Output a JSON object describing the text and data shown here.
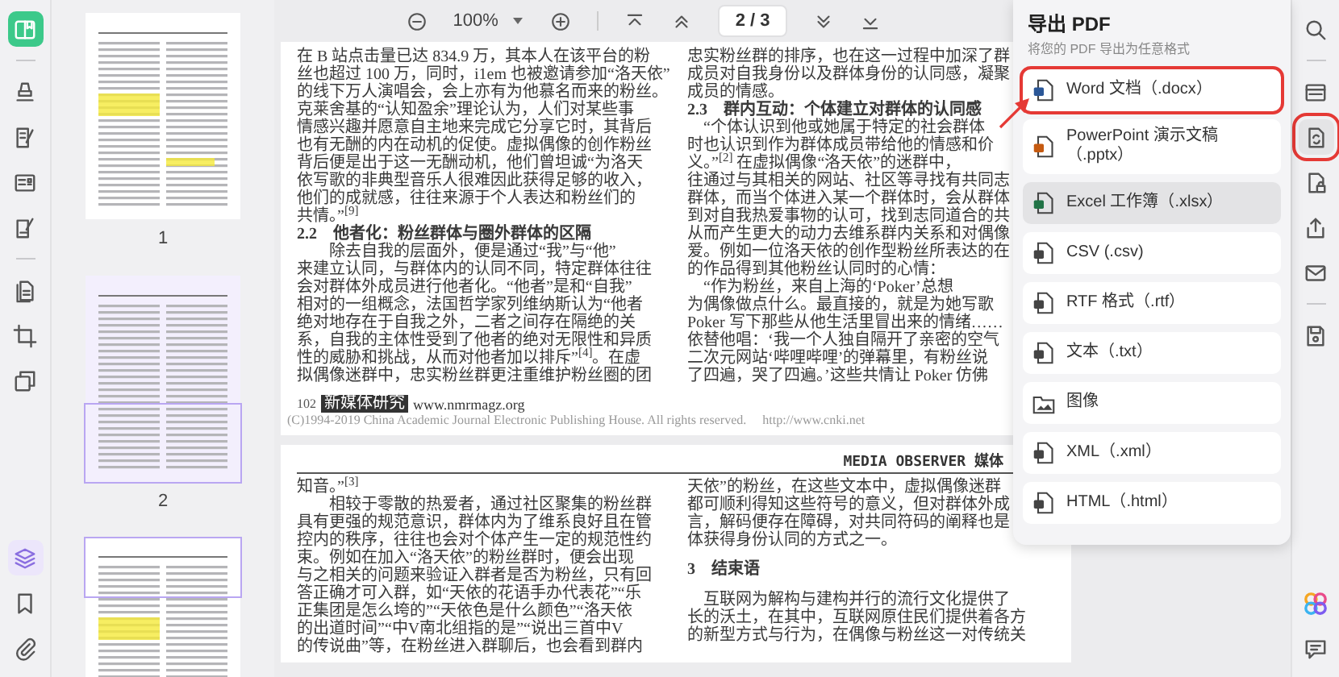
{
  "left_rail": {
    "groups": [
      [
        {
          "kind": "reader",
          "selected": true
        }
      ],
      [
        {
          "kind": "comment",
          "selected": false
        },
        {
          "kind": "edit",
          "selected": false
        },
        {
          "kind": "form",
          "selected": false
        },
        {
          "kind": "sign",
          "selected": false
        }
      ],
      [
        {
          "kind": "organize",
          "selected": false
        },
        {
          "kind": "crop",
          "selected": false
        },
        {
          "kind": "compress",
          "selected": false
        }
      ]
    ],
    "bottom": [
      {
        "kind": "layers",
        "selected": true
      },
      {
        "kind": "bookmark",
        "selected": false
      },
      {
        "kind": "attachment",
        "selected": false
      }
    ]
  },
  "thumbnails": [
    {
      "label": "1",
      "selected": false,
      "highlights": true
    },
    {
      "label": "2",
      "selected": true,
      "highlights": false
    },
    {
      "selected": false,
      "highlights": true
    }
  ],
  "toolbar": {
    "zoom": "100%",
    "page": "2 / 3"
  },
  "pages": [
    {
      "columns": [
        [
          {
            "kind": "body",
            "text": "在 B 站点击量已达 834.9 万，其本人在该平台的粉"
          },
          {
            "kind": "body",
            "text": "丝也超过 100 万，同时，i1em 也被邀请参加“洛天依”"
          },
          {
            "kind": "body",
            "text": "的线下万人演唱会，会上亦有为他慕名而来的粉丝。"
          },
          {
            "kind": "body",
            "text": "克莱舍基的“认知盈余”理论认为，人们对某些事"
          },
          {
            "kind": "body",
            "text": "情感兴趣并愿意自主地来完成它分享它时，其背后"
          },
          {
            "kind": "body",
            "text": "也有无酬的内在动机的促使。虚拟偶像的创作粉丝"
          },
          {
            "kind": "body",
            "text": "背后便是出于这一无酬动机，他们曾坦诚“为洛天"
          },
          {
            "kind": "body",
            "text": "依写歌的非典型音乐人很难因此获得足够的收入，"
          },
          {
            "kind": "body",
            "text": "他们的成就感，往往来源于个人表达和粉丝们的"
          },
          {
            "kind": "body",
            "text": "共情。”$^{[9]}$"
          },
          {
            "kind": "heading",
            "text": "2.2　他者化：粉丝群体与圈外群体的区隔"
          },
          {
            "kind": "body",
            "text": "　　除去自我的层面外，便是通过“我”与“他”"
          },
          {
            "kind": "body",
            "text": "来建立认同，与群体内的认同不同，特定群体往往"
          },
          {
            "kind": "body",
            "text": "会对群体外成员进行他者化。“他者”是和“自我”"
          },
          {
            "kind": "body",
            "text": "相对的一组概念，法国哲学家列维纳斯认为“他者"
          },
          {
            "kind": "body",
            "text": "绝对地存在于自我之外，二者之间存在隔绝的关"
          },
          {
            "kind": "body",
            "text": "系，自我的主体性受到了他者的绝对无限性和异质"
          },
          {
            "kind": "body",
            "text": "性的威胁和挑战，从而对他者加以排斥”$^{[4]}$。在虚"
          },
          {
            "kind": "body",
            "text": "拟偶像迷群中，忠实粉丝群更注重维护粉丝圈的团"
          }
        ],
        [
          {
            "kind": "body",
            "text": "忠实粉丝群的排序，也在这一过程中加深了群"
          },
          {
            "kind": "body",
            "text": "成员对自我身份以及群体身份的认同感，凝聚"
          },
          {
            "kind": "body",
            "text": "成员的情感。"
          },
          {
            "kind": "heading",
            "text": "2.3　群内互动：个体建立对群体的认同感"
          },
          {
            "kind": "body",
            "text": "　“个体认识到他或她属于特定的社会群体"
          },
          {
            "kind": "body",
            "text": "时也认识到作为群体成员带给他的情感和价"
          },
          {
            "kind": "body",
            "text": "义。”$^{[2]}$ 在虚拟偶像“洛天依”的迷群中，"
          },
          {
            "kind": "body",
            "text": "往通过与其相关的网站、社区等寻找有共同志"
          },
          {
            "kind": "body",
            "text": "群体，而当个体进入某一个群体时，会从群体"
          },
          {
            "kind": "body",
            "text": "到对自我热爱事物的认可，找到志同道合的共"
          },
          {
            "kind": "body",
            "text": "从而产生更大的动力去维系群内关系和对偶像"
          },
          {
            "kind": "body",
            "text": "爱。例如一位洛天依的创作型粉丝所表达的在"
          },
          {
            "kind": "body",
            "text": "的作品得到其他粉丝认同时的心情："
          },
          {
            "kind": "body",
            "text": "　“作为粉丝，来自上海的‘Poker’总想"
          },
          {
            "kind": "body",
            "text": "为偶像做点什么。最直接的，就是为她写歌"
          },
          {
            "kind": "body",
            "text": "Poker 写下那些从他生活里冒出来的情绪……"
          },
          {
            "kind": "body",
            "text": "依替他唱：‘我一个人独自隔开了亲密的空气"
          },
          {
            "kind": "body",
            "text": "二次元网站‘哔哩哔哩’的弹幕里，有粉丝说"
          },
          {
            "kind": "body",
            "text": "了四遍，哭了四遍。’这些共情让 Poker 仿佛"
          }
        ]
      ],
      "footer": {
        "page_number": "102",
        "journal": "新媒体研究",
        "website": "www.nmrmagz.org",
        "copyright": "(C)1994-2019 China Academic Journal Electronic Publishing House. All rights reserved.",
        "url": "http://www.cnki.net"
      }
    },
    {
      "header": "MEDIA OBSERVER 媒体",
      "columns": [
        [
          {
            "kind": "body",
            "text": "知音。”$^{[3]}$"
          },
          {
            "kind": "body",
            "text": "　　相较于零散的热爱者，通过社区聚集的粉丝群"
          },
          {
            "kind": "body",
            "text": "具有更强的规范意识，群体内为了维系良好且在管"
          },
          {
            "kind": "body",
            "text": "控内的秩序，往往也会对个体产生一定的规范性约"
          },
          {
            "kind": "body",
            "text": "束。例如在加入“洛天依”的粉丝群时，便会出现"
          },
          {
            "kind": "body",
            "text": "与之相关的问题来验证入群者是否为粉丝，只有回"
          },
          {
            "kind": "body",
            "text": "答正确才可入群，如“天依的花语手办代表花”“乐"
          },
          {
            "kind": "body",
            "text": "正集团是怎么垮的”“天依色是什么颜色”“洛天依"
          },
          {
            "kind": "body",
            "text": "的出道时间”“中V南北组指的是”“说出三首中V"
          },
          {
            "kind": "body",
            "text": "的传说曲”等，在粉丝进入群聊后，也会看到群内"
          }
        ],
        [
          {
            "kind": "body",
            "text": "天依”的粉丝，在这些文本中，虚拟偶像迷群"
          },
          {
            "kind": "body",
            "text": "都可顺利得知这些符号的意义，但对群体外成"
          },
          {
            "kind": "body",
            "text": "言，解码便存在障碍，对共同符码的阐释也是"
          },
          {
            "kind": "body",
            "text": "体获得身份认同的方式之一。"
          },
          {
            "kind": "title",
            "text": "3　结束语"
          },
          {
            "kind": "body",
            "text": "　互联网为解构与建构并行的流行文化提供了"
          },
          {
            "kind": "body",
            "text": "长的沃土，在其中，互联网原住民们提供着各方"
          },
          {
            "kind": "body",
            "text": "的新型方式与行为，在偶像与粉丝这一对传统关"
          }
        ]
      ]
    }
  ],
  "export_panel": {
    "title": "导出 PDF",
    "subtitle": "将您的 PDF 导出为任意格式",
    "options": [
      {
        "kind": "word",
        "label": "Word 文档（.docx）",
        "selected": false,
        "annotated": true
      },
      {
        "kind": "ppt",
        "label": "PowerPoint 演示文稿（.pptx）",
        "selected": false,
        "annotated": false
      },
      {
        "kind": "excel",
        "label": "Excel 工作簿（.xlsx）",
        "selected": true,
        "annotated": false
      },
      {
        "kind": "csv",
        "label": "CSV (.csv)",
        "selected": false,
        "annotated": false
      },
      {
        "kind": "rtf",
        "label": "RTF 格式（.rtf）",
        "selected": false,
        "annotated": false
      },
      {
        "kind": "txt",
        "label": "文本（.txt）",
        "selected": false,
        "annotated": false
      },
      {
        "kind": "image",
        "label": "图像",
        "selected": false,
        "annotated": false
      },
      {
        "kind": "xml",
        "label": "XML（.xml）",
        "selected": false,
        "annotated": false
      },
      {
        "kind": "html",
        "label": "HTML（.html）",
        "selected": false,
        "annotated": false
      }
    ]
  },
  "right_rail": {
    "groups": [
      [
        {
          "kind": "search",
          "selected": false,
          "annotated": false
        }
      ],
      [
        {
          "kind": "ocr",
          "selected": false,
          "annotated": false
        },
        {
          "kind": "convert",
          "selected": true,
          "annotated": true
        },
        {
          "kind": "protect",
          "selected": false,
          "annotated": false
        },
        {
          "kind": "share",
          "selected": false,
          "annotated": false
        },
        {
          "kind": "mail",
          "selected": false,
          "annotated": false
        }
      ],
      [
        {
          "kind": "save",
          "selected": false,
          "annotated": false
        }
      ]
    ],
    "bottom": [
      {
        "kind": "ai",
        "selected": false,
        "annotated": false
      },
      {
        "kind": "chat",
        "selected": false,
        "annotated": false
      }
    ]
  }
}
